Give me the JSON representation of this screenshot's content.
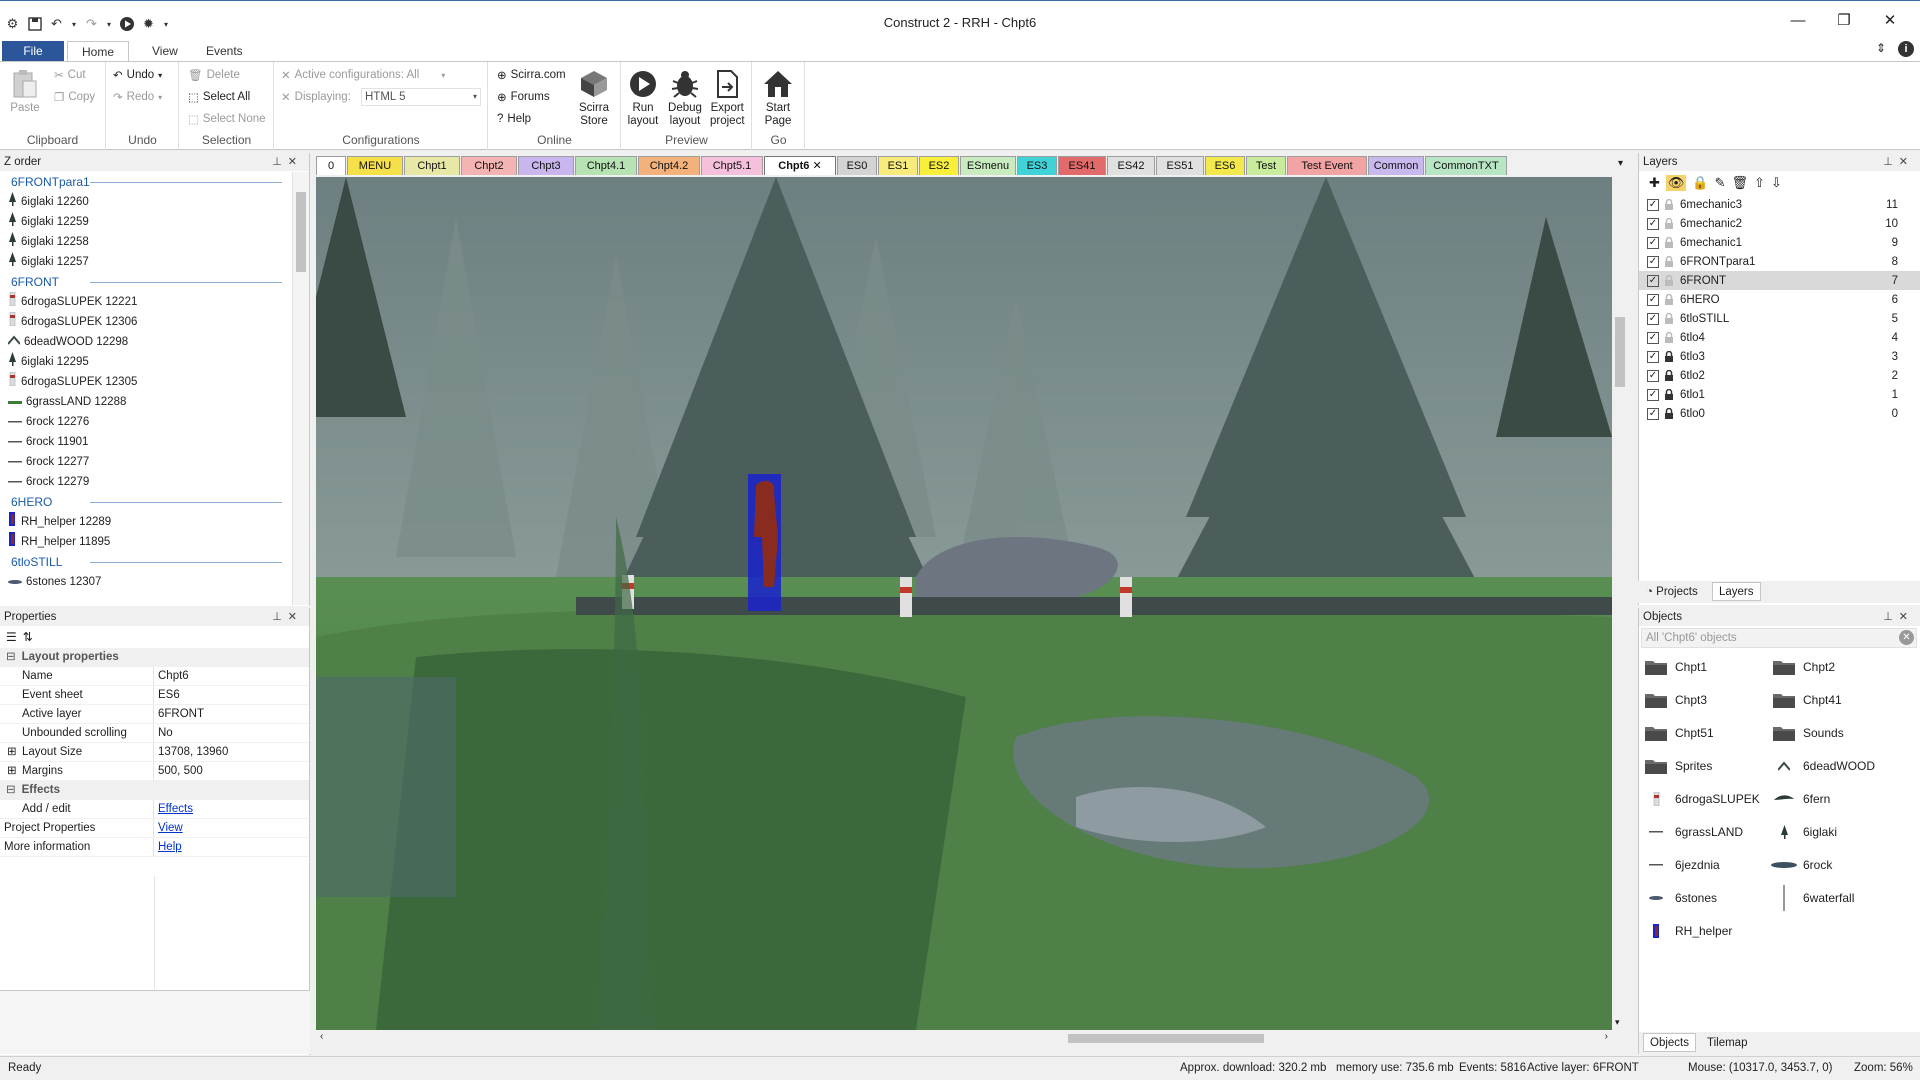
{
  "window": {
    "title": "Construct 2 - RRH - Chpt6",
    "buttons": [
      "minimize",
      "restore",
      "close"
    ]
  },
  "ribbon_tabs": [
    "File",
    "Home",
    "View",
    "Events"
  ],
  "ribbon": {
    "clipboard": {
      "paste": "Paste",
      "cut": "Cut",
      "copy": "Copy",
      "label": "Clipboard"
    },
    "undo": {
      "undo": "Undo",
      "redo": "Redo",
      "label": "Undo"
    },
    "selection": {
      "delete": "Delete",
      "select_all": "Select All",
      "select_none": "Select None",
      "label": "Selection"
    },
    "configurations": {
      "active": "Active configurations: All",
      "displaying_label": "Displaying:",
      "displaying_value": "HTML 5",
      "label": "Configurations"
    },
    "online": {
      "scirra": "Scirra.com",
      "forums": "Forums",
      "help": "Help",
      "store_line1": "Scirra",
      "store_line2": "Store",
      "label": "Online"
    },
    "preview": {
      "run1": "Run",
      "run2": "layout",
      "debug1": "Debug",
      "debug2": "layout",
      "export1": "Export",
      "export2": "project",
      "label": "Preview"
    },
    "go": {
      "start1": "Start",
      "start2": "Page",
      "label": "Go"
    }
  },
  "zorder": {
    "title": "Z order",
    "groups": [
      {
        "name": "6FRONTpara1",
        "items": [
          {
            "label": "6iglaki 12260",
            "icon": "tree"
          },
          {
            "label": "6iglaki 12259",
            "icon": "tree"
          },
          {
            "label": "6iglaki 12258",
            "icon": "tree"
          },
          {
            "label": "6iglaki 12257",
            "icon": "tree"
          }
        ]
      },
      {
        "name": "6FRONT",
        "items": [
          {
            "label": "6drogaSLUPEK 12221",
            "icon": "post"
          },
          {
            "label": "6drogaSLUPEK 12306",
            "icon": "post"
          },
          {
            "label": "6deadWOOD 12298",
            "icon": "wood"
          },
          {
            "label": "6iglaki 12295",
            "icon": "tree"
          },
          {
            "label": "6drogaSLUPEK 12305",
            "icon": "post"
          },
          {
            "label": "6grassLAND 12288",
            "icon": "grass"
          },
          {
            "label": "6rock 12276",
            "icon": "line"
          },
          {
            "label": "6rock 11901",
            "icon": "line"
          },
          {
            "label": "6rock 12277",
            "icon": "line"
          },
          {
            "label": "6rock 12279",
            "icon": "line"
          }
        ]
      },
      {
        "name": "6HERO",
        "items": [
          {
            "label": "RH_helper 12289",
            "icon": "hero"
          },
          {
            "label": "RH_helper 11895",
            "icon": "hero"
          }
        ]
      },
      {
        "name": "6tloSTILL",
        "items": [
          {
            "label": "6stones 12307",
            "icon": "stones"
          }
        ]
      }
    ]
  },
  "properties": {
    "title": "Properties",
    "categories": [
      {
        "name": "Layout properties",
        "rows": [
          {
            "key": "Name",
            "value": "Chpt6"
          },
          {
            "key": "Event sheet",
            "value": "ES6"
          },
          {
            "key": "Active layer",
            "value": "6FRONT"
          },
          {
            "key": "Unbounded scrolling",
            "value": "No"
          },
          {
            "key": "Layout Size",
            "value": "13708, 13960"
          },
          {
            "key": "Margins",
            "value": "500, 500"
          }
        ]
      },
      {
        "name": "Effects",
        "rows": [
          {
            "key": "Add / edit",
            "value": "Effects"
          }
        ]
      }
    ],
    "extra": [
      {
        "key": "Project Properties",
        "value": "View"
      },
      {
        "key": "More information",
        "value": "Help"
      }
    ]
  },
  "layout_tabs": [
    {
      "label": "0",
      "color": "#ffffff"
    },
    {
      "label": "MENU",
      "color": "#f5e04a"
    },
    {
      "label": "Chpt1",
      "color": "#e7e8a6"
    },
    {
      "label": "Chpt2",
      "color": "#f5b4b4"
    },
    {
      "label": "Chpt3",
      "color": "#c9b6ee"
    },
    {
      "label": "Chpt4.1",
      "color": "#b7e2b4"
    },
    {
      "label": "Chpt4.2",
      "color": "#f3b27b"
    },
    {
      "label": "Chpt5.1",
      "color": "#f4c0dc"
    },
    {
      "label": "Chpt6",
      "color": "#ffffff",
      "active": true
    },
    {
      "label": "ES0",
      "color": "#d3d3d3"
    },
    {
      "label": "ES1",
      "color": "#f7ec7b"
    },
    {
      "label": "ES2",
      "color": "#f7ef3a"
    },
    {
      "label": "ESmenu",
      "color": "#c8ecc0"
    },
    {
      "label": "ES3",
      "color": "#3fd3d8"
    },
    {
      "label": "ES41",
      "color": "#e36a6a"
    },
    {
      "label": "ES42",
      "color": "#e0e0e0"
    },
    {
      "label": "ES51",
      "color": "#e0e0e0"
    },
    {
      "label": "ES6",
      "color": "#f4e94c"
    },
    {
      "label": "Test",
      "color": "#c8eb9c"
    },
    {
      "label": "Test Event",
      "color": "#f2a3a3"
    },
    {
      "label": "Common",
      "color": "#c8b8ee"
    },
    {
      "label": "CommonTXT",
      "color": "#b8e6c4"
    }
  ],
  "layers": {
    "title": "Layers",
    "rows": [
      {
        "name": "6mechanic3",
        "num": "11",
        "locked": false
      },
      {
        "name": "6mechanic2",
        "num": "10",
        "locked": false
      },
      {
        "name": "6mechanic1",
        "num": "9",
        "locked": false
      },
      {
        "name": "6FRONTpara1",
        "num": "8",
        "locked": false
      },
      {
        "name": "6FRONT",
        "num": "7",
        "locked": false,
        "selected": true
      },
      {
        "name": "6HERO",
        "num": "6",
        "locked": false
      },
      {
        "name": "6tloSTILL",
        "num": "5",
        "locked": false
      },
      {
        "name": "6tlo4",
        "num": "4",
        "locked": false
      },
      {
        "name": "6tlo3",
        "num": "3",
        "locked": true
      },
      {
        "name": "6tlo2",
        "num": "2",
        "locked": true
      },
      {
        "name": "6tlo1",
        "num": "1",
        "locked": true
      },
      {
        "name": "6tlo0",
        "num": "0",
        "locked": true
      }
    ],
    "bottom_tabs": [
      "Projects",
      "Layers"
    ]
  },
  "objects": {
    "title": "Objects",
    "filter": "All 'Chpt6' objects",
    "items": [
      {
        "label": "Chpt1",
        "icon": "folder"
      },
      {
        "label": "Chpt2",
        "icon": "folder"
      },
      {
        "label": "Chpt3",
        "icon": "folder"
      },
      {
        "label": "Chpt41",
        "icon": "folder"
      },
      {
        "label": "Chpt51",
        "icon": "folder"
      },
      {
        "label": "Sounds",
        "icon": "folder"
      },
      {
        "label": "Sprites",
        "icon": "folder"
      },
      {
        "label": "6deadWOOD",
        "icon": "wood"
      },
      {
        "label": "6drogaSLUPEK",
        "icon": "post"
      },
      {
        "label": "6fern",
        "icon": "fern"
      },
      {
        "label": "6grassLAND",
        "icon": "line"
      },
      {
        "label": "6iglaki",
        "icon": "tree"
      },
      {
        "label": "6jezdnia",
        "icon": "line"
      },
      {
        "label": "6rock",
        "icon": "rock"
      },
      {
        "label": "6stones",
        "icon": "stones"
      },
      {
        "label": "6waterfall",
        "icon": "waterfall"
      },
      {
        "label": "RH_helper",
        "icon": "hero"
      }
    ],
    "bottom_tabs": [
      "Objects",
      "Tilemap"
    ]
  },
  "status": {
    "ready": "Ready",
    "download": "Approx. download: 320.2 mb",
    "memory": "memory use: 735.6 mb",
    "events": "Events: 5816",
    "active_layer": "Active layer: 6FRONT",
    "mouse": "Mouse: (10317.0, 3453.7, 0)",
    "zoom": "Zoom: 56%"
  }
}
